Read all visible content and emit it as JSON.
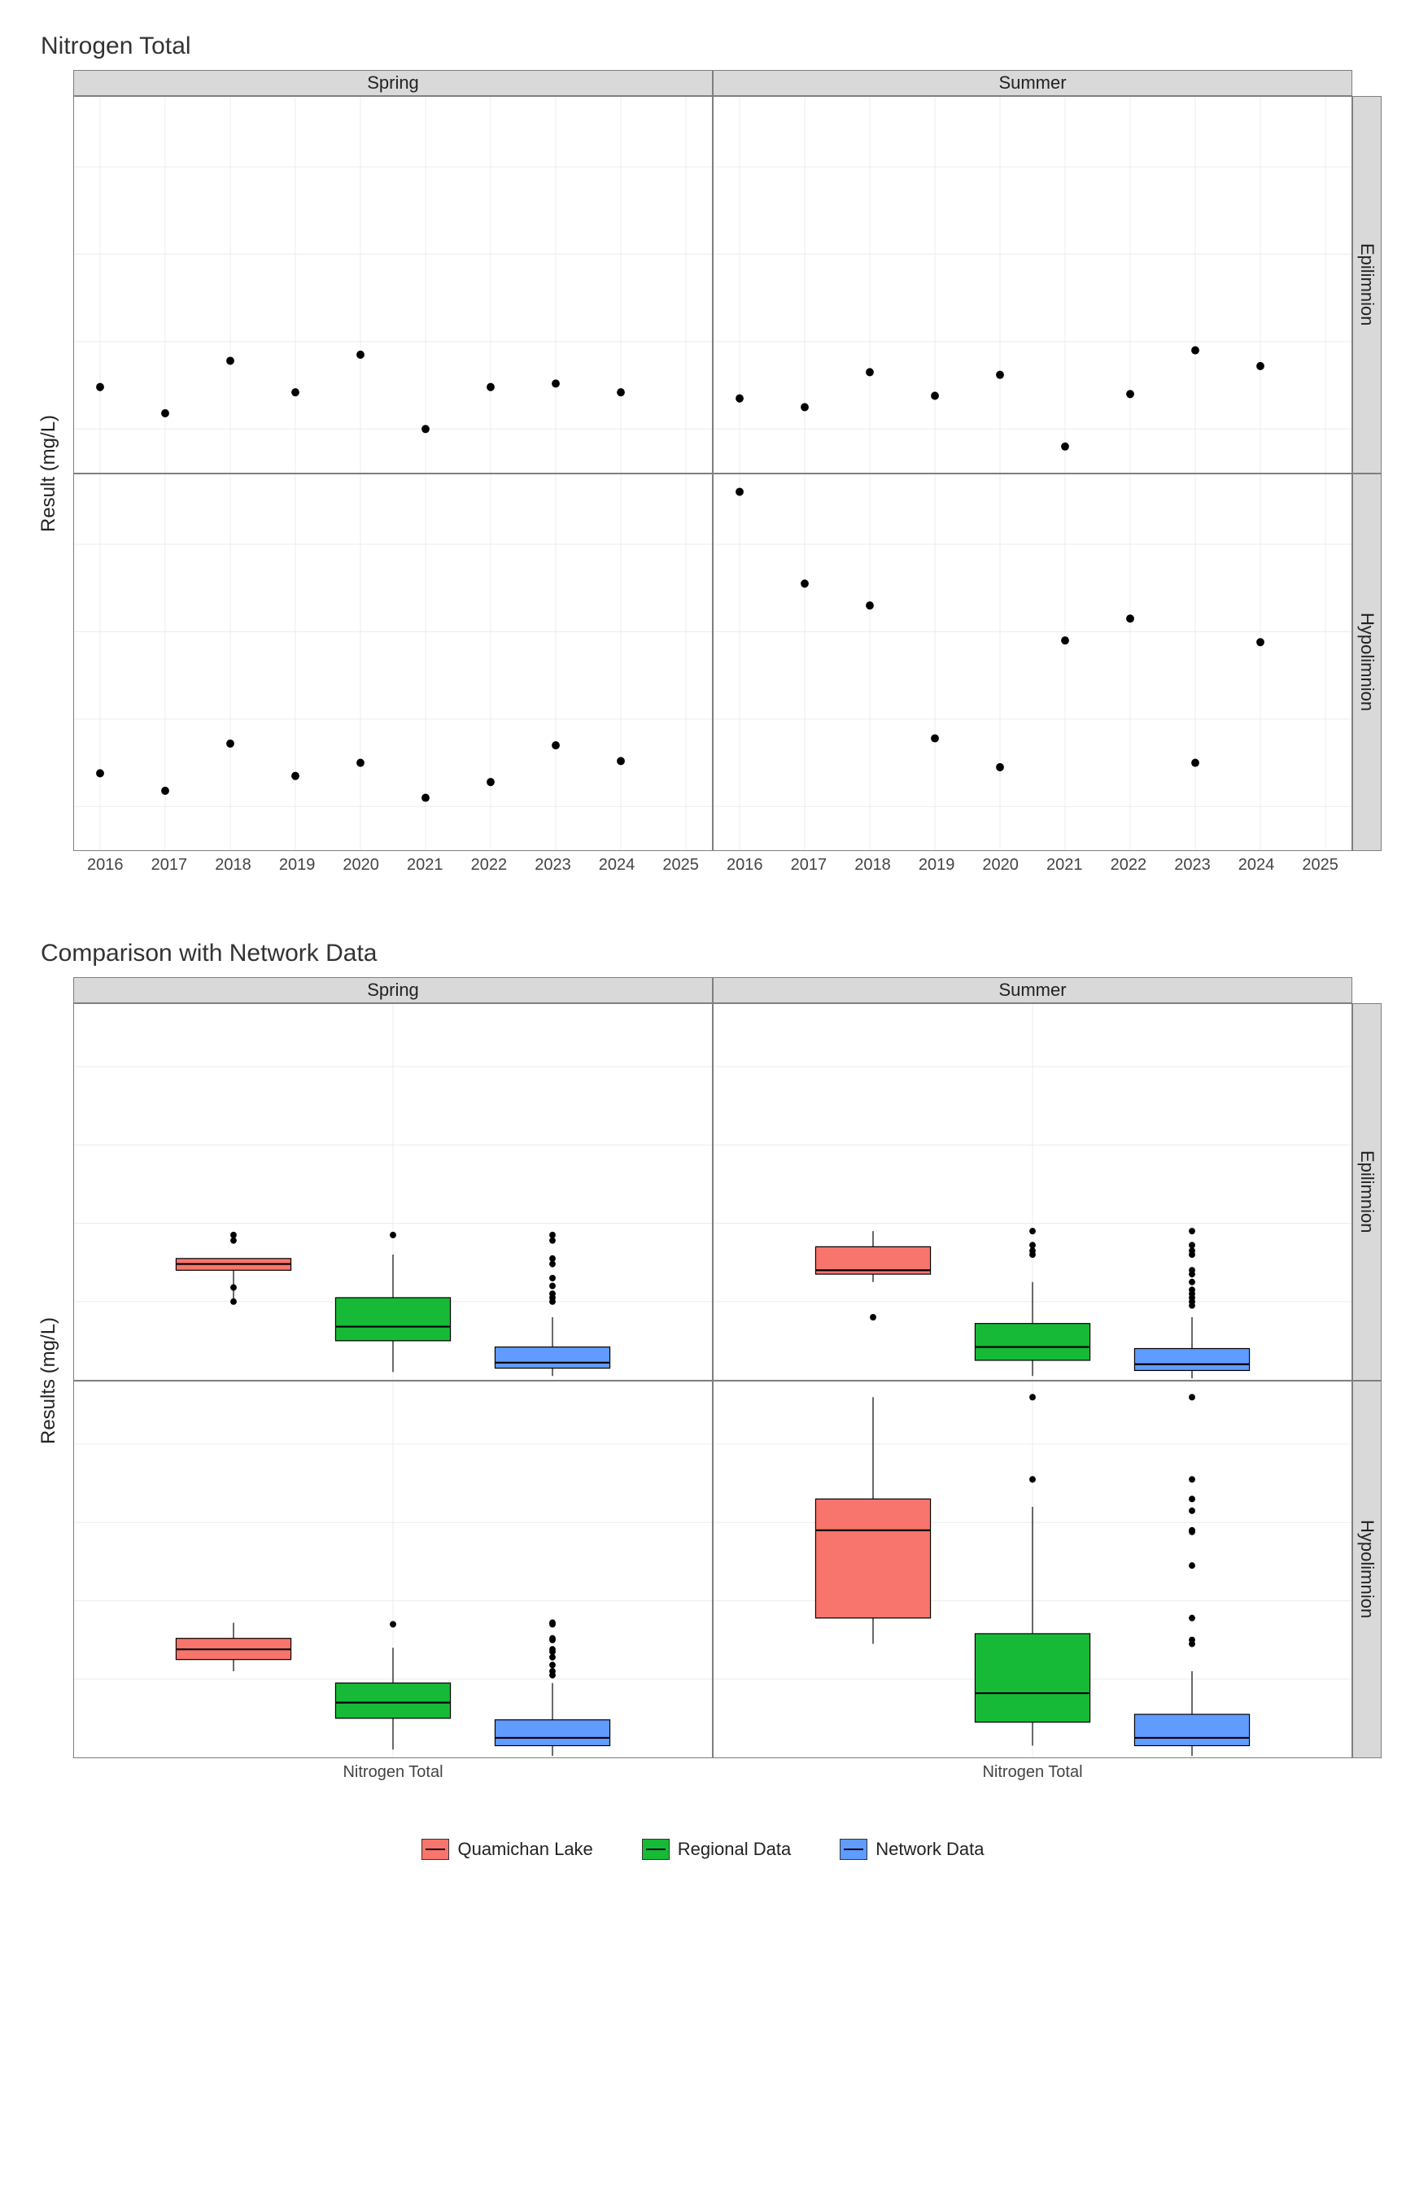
{
  "chart_data": [
    {
      "id": "scatter",
      "title": "Nitrogen Total",
      "type": "scatter",
      "ylabel": "Result (mg/L)",
      "ylim": [
        0.5,
        4.8
      ],
      "x": [
        2016,
        2017,
        2018,
        2019,
        2020,
        2021,
        2022,
        2023,
        2024,
        2025
      ],
      "col_facets": [
        "Spring",
        "Summer"
      ],
      "row_facets": [
        "Epilimnion",
        "Hypolimnion"
      ],
      "panels": {
        "Spring_Epilimnion": {
          "x": [
            2016,
            2017,
            2018,
            2019,
            2020,
            2021,
            2022,
            2023,
            2024
          ],
          "y": [
            1.48,
            1.18,
            1.78,
            1.42,
            1.85,
            1.0,
            1.48,
            1.52,
            1.42
          ]
        },
        "Summer_Epilimnion": {
          "x": [
            2016,
            2017,
            2018,
            2019,
            2020,
            2021,
            2022,
            2023,
            2024
          ],
          "y": [
            1.35,
            1.25,
            1.65,
            1.38,
            1.62,
            0.8,
            1.4,
            1.9,
            1.72
          ]
        },
        "Spring_Hypolimnion": {
          "x": [
            2016,
            2017,
            2018,
            2019,
            2020,
            2021,
            2022,
            2023,
            2024
          ],
          "y": [
            1.38,
            1.18,
            1.72,
            1.35,
            1.5,
            1.1,
            1.28,
            1.7,
            1.52
          ]
        },
        "Summer_Hypolimnion": {
          "x": [
            2016,
            2017,
            2018,
            2019,
            2020,
            2021,
            2022,
            2023,
            2024
          ],
          "y": [
            4.6,
            3.55,
            3.3,
            1.78,
            1.45,
            2.9,
            3.15,
            1.5,
            2.88
          ]
        }
      }
    },
    {
      "id": "box",
      "title": "Comparison with Network Data",
      "type": "boxplot",
      "ylabel": "Results (mg/L)",
      "xlabel": "Nitrogen Total",
      "ylim": [
        0,
        4.8
      ],
      "col_facets": [
        "Spring",
        "Summer"
      ],
      "row_facets": [
        "Epilimnion",
        "Hypolimnion"
      ],
      "series_names": [
        "Quamichan Lake",
        "Regional Data",
        "Network Data"
      ],
      "series_colors": {
        "Quamichan Lake": "#f7756c",
        "Regional Data": "#17ba37",
        "Network Data": "#609bff"
      },
      "panels": {
        "Spring_Epilimnion": {
          "Quamichan Lake": {
            "min": 1.0,
            "q1": 1.4,
            "med": 1.48,
            "q3": 1.55,
            "max": 1.55,
            "out": [
              1.85,
              1.78,
              1.18,
              1.0
            ]
          },
          "Regional Data": {
            "min": 0.1,
            "q1": 0.5,
            "med": 0.68,
            "q3": 1.05,
            "max": 1.6,
            "out": [
              1.85
            ]
          },
          "Network Data": {
            "min": 0.05,
            "q1": 0.15,
            "med": 0.22,
            "q3": 0.42,
            "max": 0.8,
            "out": [
              1.0,
              1.05,
              1.1,
              1.2,
              1.3,
              1.48,
              1.55,
              1.78,
              1.85
            ]
          }
        },
        "Summer_Epilimnion": {
          "Quamichan Lake": {
            "min": 1.25,
            "q1": 1.35,
            "med": 1.4,
            "q3": 1.7,
            "max": 1.9,
            "out": [
              0.8
            ]
          },
          "Regional Data": {
            "min": 0.05,
            "q1": 0.25,
            "med": 0.42,
            "q3": 0.72,
            "max": 1.25,
            "out": [
              1.6,
              1.65,
              1.72,
              1.9
            ]
          },
          "Network Data": {
            "min": 0.02,
            "q1": 0.12,
            "med": 0.2,
            "q3": 0.4,
            "max": 0.8,
            "out": [
              0.95,
              1.0,
              1.05,
              1.1,
              1.15,
              1.25,
              1.35,
              1.4,
              1.6,
              1.65,
              1.72,
              1.9
            ]
          }
        },
        "Spring_Hypolimnion": {
          "Quamichan Lake": {
            "min": 1.1,
            "q1": 1.25,
            "med": 1.38,
            "q3": 1.52,
            "max": 1.72,
            "out": []
          },
          "Regional Data": {
            "min": 0.1,
            "q1": 0.5,
            "med": 0.7,
            "q3": 0.95,
            "max": 1.4,
            "out": [
              1.7
            ]
          },
          "Network Data": {
            "min": 0.02,
            "q1": 0.15,
            "med": 0.25,
            "q3": 0.48,
            "max": 0.95,
            "out": [
              1.05,
              1.1,
              1.18,
              1.28,
              1.35,
              1.38,
              1.5,
              1.52,
              1.7,
              1.72
            ]
          }
        },
        "Summer_Hypolimnion": {
          "Quamichan Lake": {
            "min": 1.45,
            "q1": 1.78,
            "med": 2.9,
            "q3": 3.3,
            "max": 4.6,
            "out": []
          },
          "Regional Data": {
            "min": 0.15,
            "q1": 0.45,
            "med": 0.82,
            "q3": 1.58,
            "max": 3.2,
            "out": [
              3.55,
              4.6
            ]
          },
          "Network Data": {
            "min": 0.02,
            "q1": 0.15,
            "med": 0.25,
            "q3": 0.55,
            "max": 1.1,
            "out": [
              1.45,
              1.5,
              1.78,
              2.45,
              2.88,
              2.9,
              3.15,
              3.3,
              3.55,
              4.6
            ]
          }
        }
      }
    }
  ],
  "legend": {
    "q": "Quamichan Lake",
    "r": "Regional Data",
    "n": "Network Data"
  }
}
